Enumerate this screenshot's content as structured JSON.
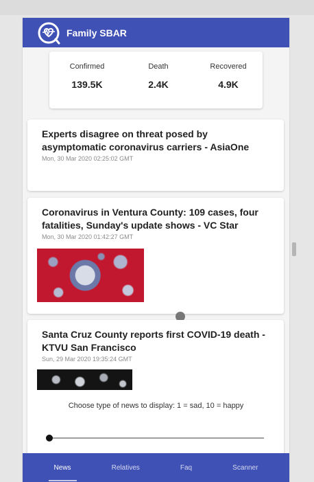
{
  "app": {
    "title": "Family SBAR"
  },
  "stats": [
    {
      "label": "Confirmed",
      "value": "139.5K"
    },
    {
      "label": "Death",
      "value": "2.4K"
    },
    {
      "label": "Recovered",
      "value": "4.9K"
    }
  ],
  "news": [
    {
      "headline": "Experts disagree on threat posed by asymptomatic coronavirus carriers - AsiaOne",
      "date": "Mon, 30 Mar 2020 02:25:02 GMT"
    },
    {
      "headline": "Coronavirus in Ventura County: 109 cases, four fatalities, Sunday's update shows - VC Star",
      "date": "Mon, 30 Mar 2020 01:42:27 GMT"
    },
    {
      "headline": "Santa Cruz County reports first COVID-19 death - KTVU San Francisco",
      "date": "Sun, 29 Mar 2020 19:35:24 GMT"
    }
  ],
  "filter": {
    "prompt": "Choose type of news to display: 1 = sad, 10 = happy",
    "value": 1,
    "min": 1,
    "max": 10
  },
  "nav": [
    {
      "label": "News",
      "active": true
    },
    {
      "label": "Relatives",
      "active": false
    },
    {
      "label": "Faq",
      "active": false
    },
    {
      "label": "Scanner",
      "active": false
    }
  ],
  "colors": {
    "primary": "#3f51b5"
  }
}
